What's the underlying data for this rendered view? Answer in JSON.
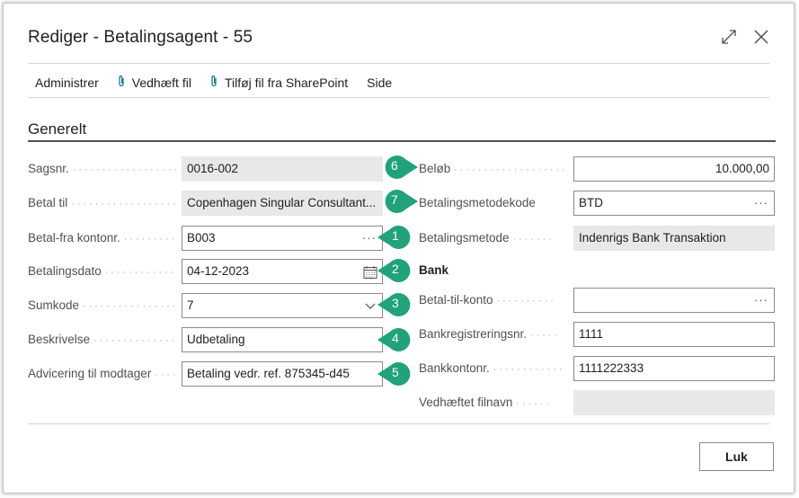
{
  "dialog": {
    "title": "Rediger - Betalingsagent - 55",
    "expand_icon": "expand-icon",
    "close_icon": "close-icon"
  },
  "actions": {
    "manage": "Administrer",
    "attach": "Vedhæft fil",
    "attach_sharepoint": "Tilføj fil fra SharePoint",
    "page": "Side"
  },
  "section": {
    "title": "Generelt"
  },
  "left": {
    "case_no": {
      "label": "Sagsnr.",
      "value": "0016-002"
    },
    "pay_to": {
      "label": "Betal til",
      "value": "Copenhagen Singular Consultant..."
    },
    "from_account": {
      "label": "Betal-fra kontonr.",
      "value": "B003"
    },
    "pay_date": {
      "label": "Betalingsdato",
      "value": "04-12-2023"
    },
    "sum_code": {
      "label": "Sumkode",
      "value": "7"
    },
    "description": {
      "label": "Beskrivelse",
      "value": "Udbetaling"
    },
    "advice": {
      "label": "Advicering til modtager",
      "value": "Betaling vedr. ref. 875345-d45"
    }
  },
  "right": {
    "amount": {
      "label": "Beløb",
      "value": "10.000,00"
    },
    "method_code": {
      "label": "Betalingsmetodekode",
      "value": "BTD"
    },
    "method": {
      "label": "Betalingsmetode",
      "value": "Indenrigs Bank Transaktion"
    },
    "bank_group": "Bank",
    "to_account": {
      "label": "Betal-til-konto",
      "value": ""
    },
    "reg_no": {
      "label": "Bankregistreringsnr.",
      "value": "1111"
    },
    "account_no": {
      "label": "Bankkontonr.",
      "value": "1111222333"
    },
    "attachment": {
      "label": "Vedhæftet filnavn",
      "value": ""
    }
  },
  "badges": [
    "1",
    "2",
    "3",
    "4",
    "5",
    "6",
    "7"
  ],
  "colors": {
    "badge": "#21a27a",
    "readonly": "#e8e8e8",
    "clip": "#1f7a8c"
  },
  "footer": {
    "close_label": "Luk"
  }
}
